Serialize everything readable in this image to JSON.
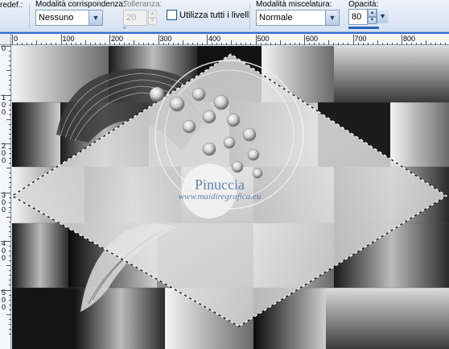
{
  "toolbar": {
    "preset_label": "redef.:",
    "match_mode_label": "Modalità corrispondenza:",
    "match_mode_value": "Nessuno",
    "tolerance_label": "Tolleranza:",
    "tolerance_value": "20",
    "all_layers_label": "Utilizza tutti i livelli",
    "blend_mode_label": "Modalità miscelatura:",
    "blend_mode_value": "Normale",
    "opacity_label": "Opacità:",
    "opacity_value": "80",
    "opacity_fraction": 0.8
  },
  "ruler": {
    "top_labels": [
      "0",
      "100",
      "200",
      "300",
      "400",
      "500",
      "600",
      "700",
      "800"
    ],
    "left_labels": [
      "0",
      "1\n0\n0",
      "2\n0\n0",
      "3\n0\n0",
      "4\n0\n0",
      "5\n0\n0"
    ]
  },
  "watermark": {
    "name": "Pinuccia",
    "site": "www.maidiregrafica.eu"
  },
  "colors": {
    "toolbar_bg": "#dfe9f5",
    "accent": "#2f6fd0",
    "selection": "#000000"
  }
}
